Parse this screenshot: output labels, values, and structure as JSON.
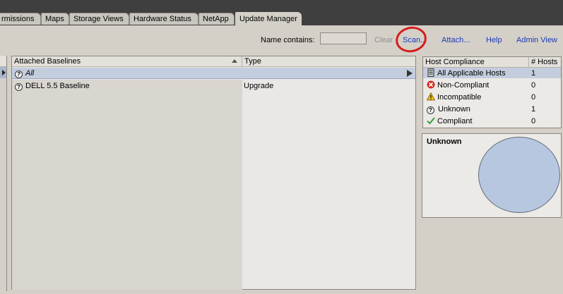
{
  "tabs": [
    {
      "label": "rmissions"
    },
    {
      "label": "Maps"
    },
    {
      "label": "Storage Views"
    },
    {
      "label": "Hardware Status"
    },
    {
      "label": "NetApp"
    },
    {
      "label": "Update Manager"
    }
  ],
  "toolbar": {
    "name_label": "Name contains:",
    "name_value": "",
    "clear": "Clear",
    "scan": "Scan...",
    "attach": "Attach...",
    "help": "Help",
    "admin_view": "Admin View"
  },
  "baselines": {
    "columns": [
      "Attached Baselines",
      "Type"
    ],
    "rows": [
      {
        "name": "All",
        "type": ""
      },
      {
        "name": "DELL 5.5 Baseline",
        "type": "Upgrade"
      }
    ]
  },
  "host_compliance": {
    "columns": [
      "Host Compliance",
      "# Hosts"
    ],
    "rows": [
      {
        "label": "All Applicable Hosts",
        "count": "1",
        "icon": "server-icon"
      },
      {
        "label": "Non-Compliant",
        "count": "0",
        "icon": "non-compliant-icon"
      },
      {
        "label": "Incompatible",
        "count": "0",
        "icon": "warning-icon"
      },
      {
        "label": "Unknown",
        "count": "1",
        "icon": "question-icon"
      },
      {
        "label": "Compliant",
        "count": "0",
        "icon": "checkmark-icon"
      }
    ]
  },
  "detail": {
    "title": "Unknown",
    "pie_fill_fraction": 1.0,
    "pie_color": "#b7c7df"
  }
}
